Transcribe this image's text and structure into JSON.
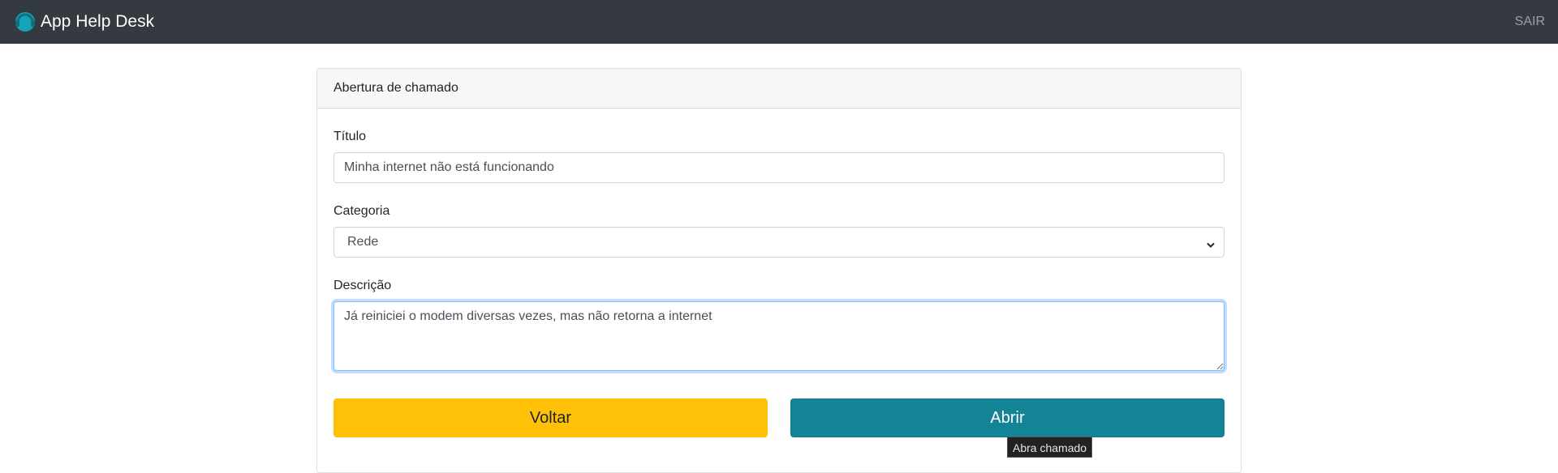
{
  "navbar": {
    "brand_icon": "headset-icon",
    "brand_text": "App Help Desk",
    "logout_label": "SAIR",
    "background": "#343a40"
  },
  "card": {
    "header_title": "Abertura de chamado"
  },
  "form": {
    "title_label": "Título",
    "title_value": "Minha internet não está funcionando",
    "category_label": "Categoria",
    "category_value": "Rede",
    "description_label": "Descrição",
    "description_value": "Já reiniciei o modem diversas vezes, mas não retorna a internet"
  },
  "buttons": {
    "back_label": "Voltar",
    "back_color": "#ffc107",
    "open_label": "Abrir",
    "open_color": "#138496"
  },
  "tooltip": {
    "text": "Abra chamado"
  }
}
